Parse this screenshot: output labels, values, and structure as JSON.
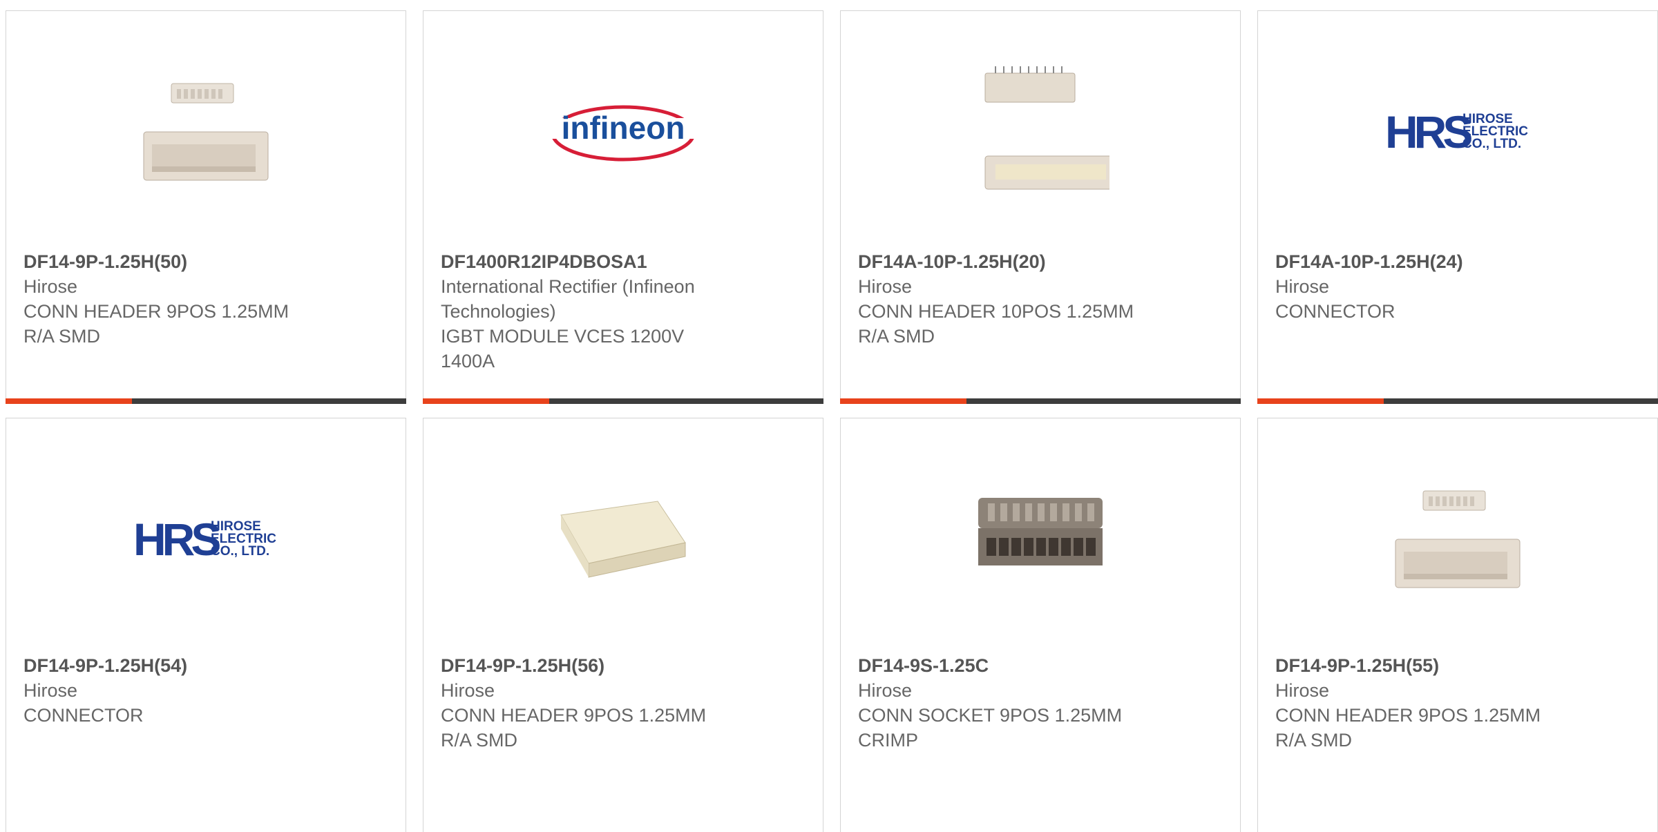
{
  "products": [
    {
      "part": "DF14-9P-1.25H(50)",
      "manufacturer": "Hirose",
      "desc1": "CONN HEADER 9POS 1.25MM",
      "desc2": "R/A SMD",
      "image": "connector-header-pair-icon"
    },
    {
      "part": "DF1400R12IP4DBOSA1",
      "manufacturer": "International Rectifier (Infineon",
      "manufacturer2": "Technologies)",
      "desc1": "IGBT MODULE VCES 1200V",
      "desc2": "1400A",
      "image": "infineon-logo",
      "logo_text": "infineon"
    },
    {
      "part": "DF14A-10P-1.25H(20)",
      "manufacturer": "Hirose",
      "desc1": "CONN HEADER 10POS 1.25MM",
      "desc2": "R/A SMD",
      "image": "connector-header-pair-icon"
    },
    {
      "part": "DF14A-10P-1.25H(24)",
      "manufacturer": "Hirose",
      "desc1": "CONNECTOR",
      "desc2": "",
      "image": "hrs-logo",
      "logo_text": "HRS",
      "logo_sub1": "HIROSE",
      "logo_sub2": "ELECTRIC",
      "logo_sub3": "CO., LTD."
    },
    {
      "part": "DF14-9P-1.25H(54)",
      "manufacturer": "Hirose",
      "desc1": "CONNECTOR",
      "desc2": "",
      "image": "hrs-logo",
      "logo_text": "HRS",
      "logo_sub1": "HIROSE",
      "logo_sub2": "ELECTRIC",
      "logo_sub3": "CO., LTD."
    },
    {
      "part": "DF14-9P-1.25H(56)",
      "manufacturer": "Hirose",
      "desc1": "CONN HEADER 9POS 1.25MM",
      "desc2": "R/A SMD",
      "image": "connector-header-icon"
    },
    {
      "part": "DF14-9S-1.25C",
      "manufacturer": "Hirose",
      "desc1": "CONN SOCKET 9POS 1.25MM",
      "desc2": "CRIMP",
      "image": "connector-socket-icon"
    },
    {
      "part": "DF14-9P-1.25H(55)",
      "manufacturer": "Hirose",
      "desc1": "CONN HEADER 9POS 1.25MM",
      "desc2": "R/A SMD",
      "image": "connector-header-pair-icon"
    }
  ],
  "colors": {
    "accent": "#e8431c",
    "bar": "#3d3d3d",
    "hrs_blue": "#1f3f94",
    "infineon_blue": "#1a4f9c",
    "infineon_red": "#d71e37"
  }
}
